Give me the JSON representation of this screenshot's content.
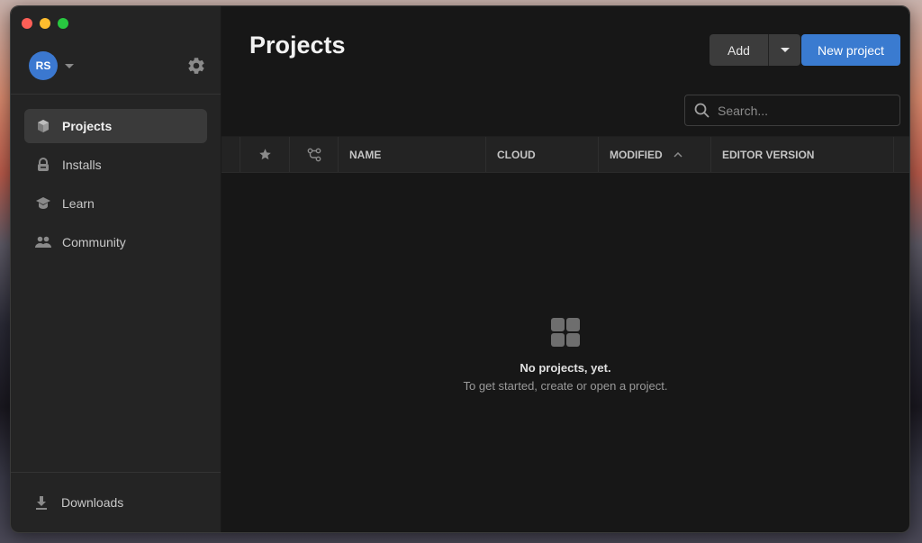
{
  "window": {
    "traffic_lights": [
      "close",
      "minimize",
      "maximize"
    ]
  },
  "account": {
    "initials": "RS",
    "avatar_color": "#3b78d0"
  },
  "sidebar": {
    "items": [
      {
        "label": "Projects",
        "icon": "cube-icon",
        "active": true
      },
      {
        "label": "Installs",
        "icon": "lock-icon",
        "active": false
      },
      {
        "label": "Learn",
        "icon": "graduation-cap-icon",
        "active": false
      },
      {
        "label": "Community",
        "icon": "people-icon",
        "active": false
      }
    ],
    "bottom": {
      "label": "Downloads",
      "icon": "download-icon"
    }
  },
  "header": {
    "title": "Projects",
    "add_label": "Add",
    "new_project_label": "New project",
    "accent_color": "#3a7bd0"
  },
  "search": {
    "placeholder": "Search...",
    "value": ""
  },
  "table": {
    "columns": [
      {
        "label": "",
        "icon": "star-icon"
      },
      {
        "label": "",
        "icon": "branch-icon"
      },
      {
        "label": "NAME"
      },
      {
        "label": "CLOUD"
      },
      {
        "label": "MODIFIED",
        "sort": "ascending"
      },
      {
        "label": "EDITOR VERSION"
      }
    ],
    "rows": []
  },
  "empty_state": {
    "title": "No projects, yet.",
    "subtitle": "To get started, create or open a project."
  }
}
